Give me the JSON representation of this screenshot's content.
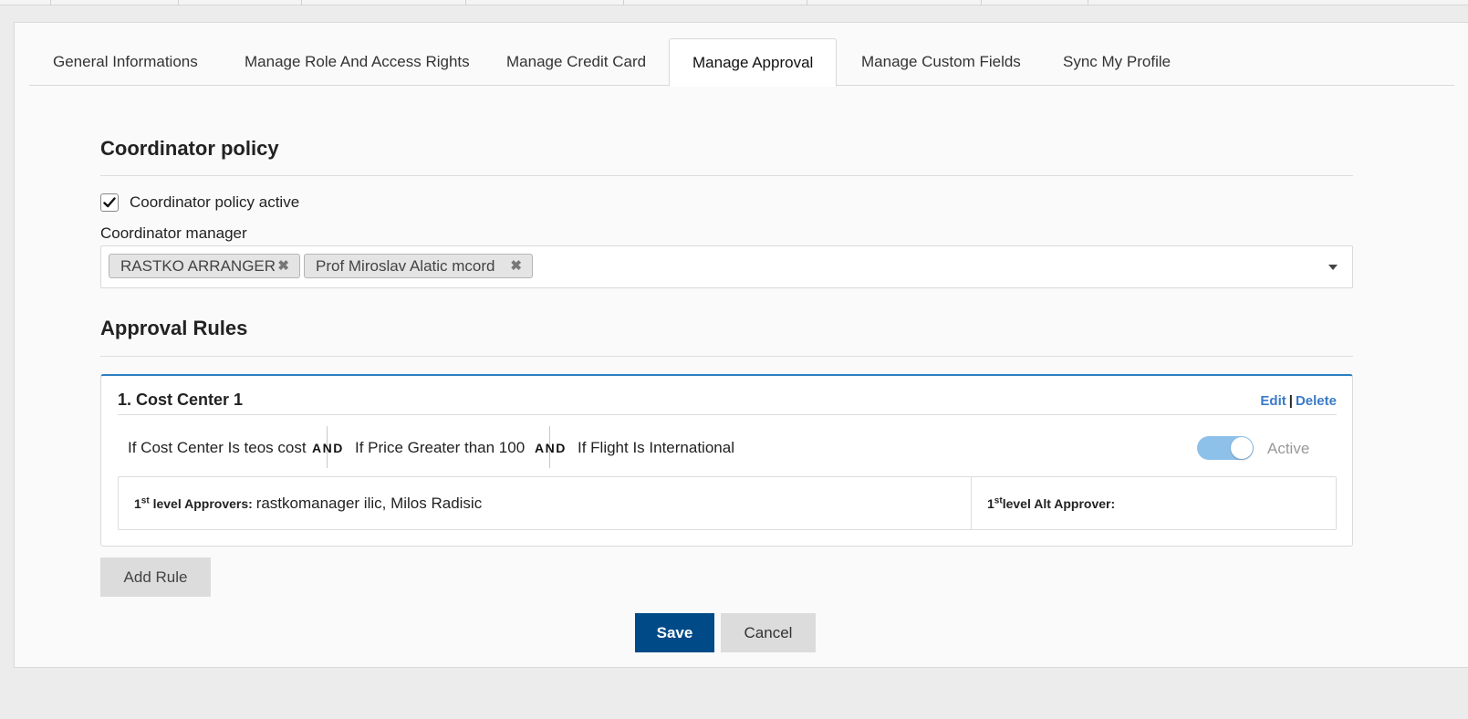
{
  "tabs": [
    {
      "label": "General Informations",
      "active": false
    },
    {
      "label": "Manage Role And Access Rights",
      "active": false
    },
    {
      "label": "Manage Credit Card",
      "active": false
    },
    {
      "label": "Manage Approval",
      "active": true
    },
    {
      "label": "Manage Custom Fields",
      "active": false
    },
    {
      "label": "Sync My Profile",
      "active": false
    }
  ],
  "coordinator": {
    "section_title": "Coordinator policy",
    "active_label": "Coordinator policy active",
    "active_checked": true,
    "manager_label": "Coordinator manager",
    "managers": [
      "RASTKO ARRANGER",
      "Prof Miroslav Alatic mcord"
    ],
    "remove_glyph": "✖"
  },
  "approval": {
    "section_title": "Approval Rules",
    "rules": [
      {
        "title": "1. Cost Center 1",
        "edit_label": "Edit",
        "separator": "|",
        "delete_label": "Delete",
        "conditions": [
          "If Cost Center Is teos cost",
          "If Price Greater than 100",
          "If Flight Is International"
        ],
        "operators": [
          "AND",
          "AND"
        ],
        "active": true,
        "status_label": "Active",
        "approvers": {
          "level": "1",
          "level_sup": "st",
          "label": " level Approvers: ",
          "value": "rastkomanager ilic, Milos Radisic"
        },
        "alt_approver": {
          "level": "1",
          "level_sup": "st",
          "label": "level Alt Approver:",
          "value": ""
        }
      }
    ]
  },
  "buttons": {
    "add_rule": "Add Rule",
    "save": "Save",
    "cancel": "Cancel"
  },
  "colors": {
    "primary": "#004a87",
    "link": "#3a7bc8",
    "toggle_on": "#8ec1ea",
    "card_accent": "#2d7fc1"
  }
}
